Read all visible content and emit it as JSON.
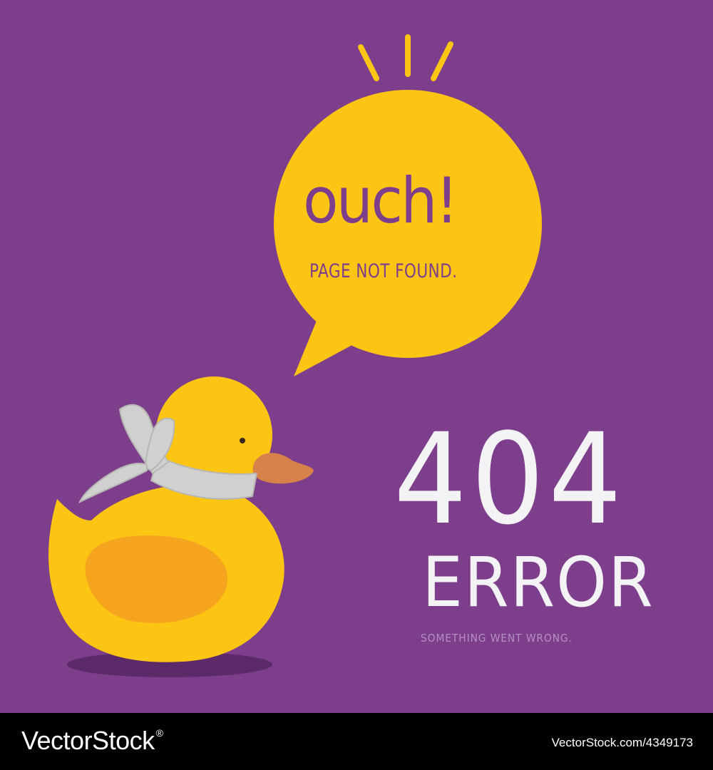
{
  "message": {
    "exclamation": "ouch!",
    "subtitle": "PAGE NOT FOUND."
  },
  "error": {
    "code": "404",
    "label": "ERROR",
    "detail": "SOMETHING WENT WRONG."
  },
  "watermark": {
    "brand": "VectorStock",
    "registered": "®",
    "url": "VectorStock.com/4349173"
  },
  "icons": [
    "speech-bubble-icon",
    "emphasis-lines-icon",
    "rubber-duck-icon",
    "bandage-icon"
  ],
  "colors": {
    "background": "#7d3e8c",
    "bubble": "#fdc513",
    "duck": "#fdc513",
    "wing": "#f6a31e",
    "beak": "#d7824a",
    "bandage": "#d0d0cf",
    "text_light": "#f3f2f4",
    "footer": "#000000"
  }
}
